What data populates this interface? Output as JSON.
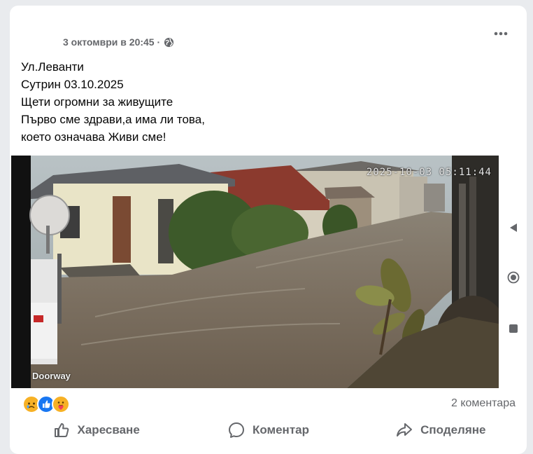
{
  "post": {
    "timestamp": "3 октомври в 20:45 ·",
    "privacy_icon": "globe-icon",
    "more_icon": "more-horizontal-icon",
    "text_lines": [
      "Ул.Леванти",
      "Сутрин 03.10.2025",
      "Щети огромни за живущите",
      "Първо сме здрави,а има ли това,",
      "което означава Живи сме!"
    ]
  },
  "video": {
    "timestamp_overlay": "2025-10-03 05:11:44",
    "watermark": "Doorway"
  },
  "gallery_controls": {
    "icons": [
      "triangle-left-icon",
      "record-icon",
      "stop-icon"
    ]
  },
  "reactions": {
    "icons": [
      "sad-emoji-icon",
      "like-icon",
      "care-emoji-icon"
    ],
    "comments": "2 коментара"
  },
  "actions": {
    "like": "Харесване",
    "comment": "Коментар",
    "share": "Споделяне"
  },
  "colors": {
    "secondary_text": "#65676b",
    "like_blue": "#1877f2",
    "care_yellow": "#f7b125",
    "care_red": "#f33e58"
  }
}
